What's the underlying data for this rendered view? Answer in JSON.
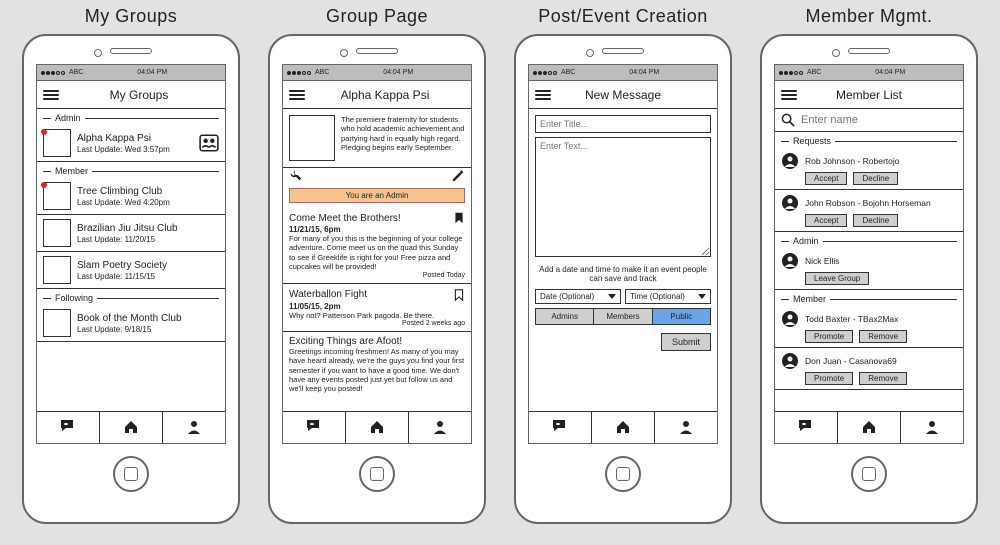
{
  "common": {
    "carrier": "ABC",
    "time": "04:04 PM"
  },
  "columns": [
    {
      "title": "My Groups"
    },
    {
      "title": "Group Page"
    },
    {
      "title": "Post/Event Creation"
    },
    {
      "title": "Member Mgmt."
    }
  ],
  "my_groups": {
    "header": "My Groups",
    "sections": {
      "admin": "Admin",
      "member": "Member",
      "following": "Following"
    },
    "items": {
      "akp": {
        "title": "Alpha Kappa Psi",
        "sub": "Last Update: Wed 3:57pm",
        "has_dot": true
      },
      "tree": {
        "title": "Tree Climbing Club",
        "sub": "Last Update: Wed 4:20pm",
        "has_dot": true
      },
      "bjj": {
        "title": "Brazilian Jiu Jitsu Club",
        "sub": "Last Update: 11/20/15"
      },
      "slam": {
        "title": "Slam Poetry Society",
        "sub": "Last Update: 11/15/15"
      },
      "book": {
        "title": "Book of the Month Club",
        "sub": "Last Update: 9/18/15"
      }
    }
  },
  "group_page": {
    "header": "Alpha Kappa Psi",
    "description": "The premiere fraternity for students who hold academic achievement and partying hard in equally high regard. Pledging begins early September.",
    "admin_banner": "You are an Admin",
    "posts": [
      {
        "title": "Come Meet the Brothers!",
        "meta": "11/21/15, 6pm",
        "body": "For many of you this is the beginning of your college adventure. Come meet us on the quad this Sunday to see if Greeklife is right for you! Free pizza and cupcakes will be provided!",
        "footer": "Posted Today",
        "bookmarked": true
      },
      {
        "title": "Waterballon Fight",
        "meta": "11/05/15, 2pm",
        "body": "Why not? Patterson Park pagoda. Be there.",
        "footer": "Posted 2 weeks ago",
        "bookmarked": false
      },
      {
        "title": "Exciting Things are Afoot!",
        "meta": "",
        "body": "Greetings incoming freshmen! As many of you may have heard already, we're the guys you find your first semester if you want to have a good time. We don't have any events posted just yet but follow us and we'll keep you posted!",
        "footer": ""
      }
    ]
  },
  "new_message": {
    "header": "New Message",
    "title_placeholder": "Enter Title...",
    "text_placeholder": "Enter Text...",
    "hint": "Add a date and time to make it an event people can save and track",
    "date_label": "Date (Optional)",
    "time_label": "Time (Optional)",
    "tabs": {
      "admins": "Admins",
      "members": "Members",
      "public": "Public"
    },
    "submit": "Submit"
  },
  "member_list": {
    "header": "Member List",
    "search_placeholder": "Enter name",
    "sections": {
      "requests": "Requests",
      "admin": "Admin",
      "member": "Member"
    },
    "requests": [
      {
        "name": "Rob Johnson - Robertojo",
        "btn1": "Accept",
        "btn2": "Decline"
      },
      {
        "name": "John Robson - Bojohn Horseman",
        "btn1": "Accept",
        "btn2": "Decline"
      }
    ],
    "admin": [
      {
        "name": "Nick Ellis",
        "btn1": "Leave Group"
      }
    ],
    "member": [
      {
        "name": "Todd Baxter - TBax2Max",
        "btn1": "Promote",
        "btn2": "Remove"
      },
      {
        "name": "Don Juan - Casanova69",
        "btn1": "Promote",
        "btn2": "Remove"
      }
    ]
  }
}
